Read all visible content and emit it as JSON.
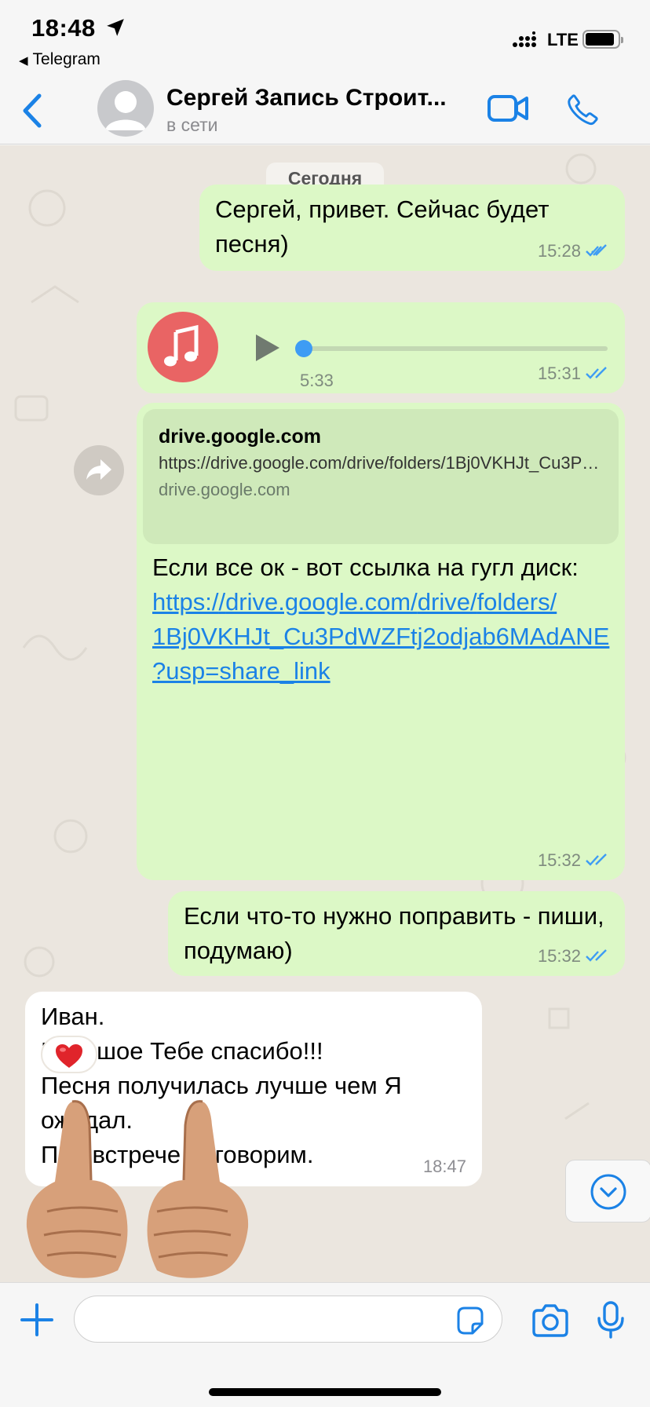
{
  "status_bar": {
    "time": "18:48",
    "back_app": "Telegram",
    "network": "LTE",
    "icons": [
      "location-arrow-icon",
      "signal-icon",
      "battery-icon"
    ]
  },
  "header": {
    "contact_name": "Сергей Запись Строит...",
    "contact_status": "в сети",
    "icons": [
      "back-chevron-icon",
      "avatar-placeholder-icon",
      "video-call-icon",
      "phone-icon"
    ]
  },
  "chat": {
    "date_label": "Сегодня",
    "messages": [
      {
        "text": "Сергей, привет. Сейчас будет песня)",
        "time": "15:28"
      },
      {
        "voice_duration": "5:33",
        "time": "15:31",
        "audio_progress": 0
      },
      {
        "link_preview": {
          "title": "drive.google.com",
          "url": "https://drive.google.com/drive/folders/1Bj0VKHJt_Cu3PdWZFtj2odjab6MAdANE?usp=...",
          "domain": "drive.google.com"
        },
        "text_prefix": "Если все ок - вот ссылка на гугл диск: ",
        "link_text": "https://drive.google.com/drive/folders/1Bj0VKHJt_Cu3PdWZFtj2odjab6MAdANE?usp=share_link",
        "time": "15:32"
      },
      {
        "text": "Если что-то нужно поправить - пиши, подумаю)",
        "time": "15:32"
      },
      {
        "lines": [
          "Иван.",
          "Большое Тебе спасибо!!!",
          "Песня получилась лучше чем Я ожидал.",
          "При встрече обговорим."
        ],
        "time": "18:47",
        "reaction": "❤️"
      }
    ],
    "sticker": "thumbs-up-hands-sticker"
  },
  "input": {
    "placeholder": "",
    "icons": [
      "plus-icon",
      "sticker-icon",
      "camera-icon",
      "microphone-icon",
      "chevron-down-circle-icon"
    ]
  },
  "colors": {
    "outgoing_bubble": "#dcf8c6",
    "incoming_bubble": "#ffffff",
    "chat_bg": "#ebe6df",
    "accent": "#1b82e6",
    "music_icon_bg": "#e96464",
    "read_ticks": "#3e9cf4"
  }
}
